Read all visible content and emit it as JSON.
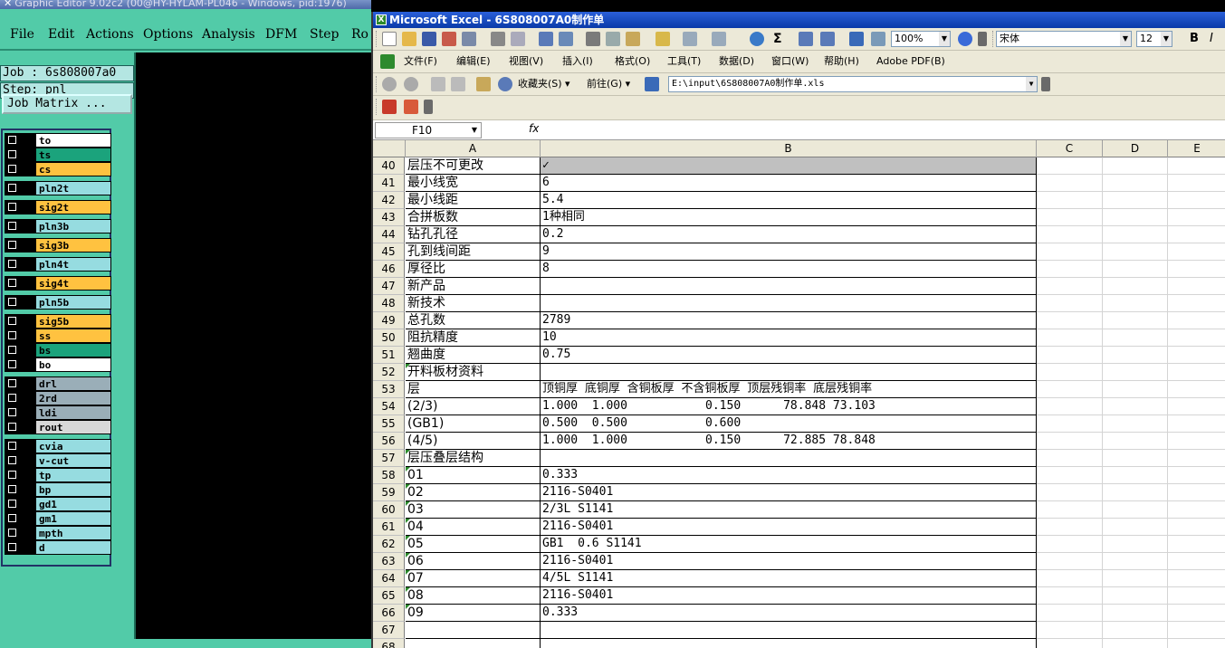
{
  "ge": {
    "title": "Graphic Editor 9.02c2 (00@HY-HYLAM-PL046 - Windows, pid:1976)",
    "menu": [
      "File",
      "Edit",
      "Actions",
      "Options",
      "Analysis",
      "DFM",
      "Step",
      "Ro"
    ],
    "job": "Job : 6s808007a0",
    "step": "Step: pnl",
    "job_matrix": "Job Matrix ...",
    "layers": [
      {
        "name": "to",
        "color": "#ffffff"
      },
      {
        "name": "ts",
        "color": "#1ba37c"
      },
      {
        "name": "cs",
        "color": "#ffc240"
      },
      {
        "name": "pln2t",
        "color": "#96dce0"
      },
      {
        "name": "sig2t",
        "color": "#ffc240"
      },
      {
        "name": "pln3b",
        "color": "#96dce0"
      },
      {
        "name": "sig3b",
        "color": "#ffc240"
      },
      {
        "name": "pln4t",
        "color": "#96dce0"
      },
      {
        "name": "sig4t",
        "color": "#ffc240"
      },
      {
        "name": "pln5b",
        "color": "#96dce0"
      },
      {
        "name": "sig5b",
        "color": "#ffc240"
      },
      {
        "name": "ss",
        "color": "#ffc240"
      },
      {
        "name": "bs",
        "color": "#1ba37c"
      },
      {
        "name": "bo",
        "color": "#ffffff"
      },
      {
        "name": "drl",
        "color": "#9aaeb8"
      },
      {
        "name": "2rd",
        "color": "#9aaeb8"
      },
      {
        "name": "ldi",
        "color": "#9aaeb8"
      },
      {
        "name": "rout",
        "color": "#d8d8d8"
      },
      {
        "name": "cvia",
        "color": "#96dce0"
      },
      {
        "name": "v-cut",
        "color": "#96dce0"
      },
      {
        "name": "tp",
        "color": "#96dce0"
      },
      {
        "name": "bp",
        "color": "#96dce0"
      },
      {
        "name": "gd1",
        "color": "#96dce0"
      },
      {
        "name": "gm1",
        "color": "#96dce0"
      },
      {
        "name": "mpth",
        "color": "#96dce0"
      },
      {
        "name": "d",
        "color": "#96dce0"
      }
    ]
  },
  "excel": {
    "title": "Microsoft Excel - 6S808007A0制作单",
    "zoom": "100%",
    "font": "宋体",
    "size": "12",
    "menu": [
      "文件(F)",
      "编辑(E)",
      "视图(V)",
      "插入(I)",
      "格式(O)",
      "工具(T)",
      "数据(D)",
      "窗口(W)",
      "帮助(H)",
      "Adobe PDF(B)"
    ],
    "favorites": "收藏夹(S) ▾",
    "goto": "前往(G) ▾",
    "address": "E:\\input\\6S808007A0制作单.xls",
    "namebox": "F10",
    "fx": "fx",
    "columns": [
      "A",
      "B",
      "C",
      "D",
      "E"
    ],
    "rows": [
      {
        "n": "40",
        "a": "层压不可更改",
        "b": "✓"
      },
      {
        "n": "41",
        "a": "最小线宽",
        "b": "6"
      },
      {
        "n": "42",
        "a": "最小线距",
        "b": "5.4"
      },
      {
        "n": "43",
        "a": "合拼板数",
        "b": "1种相同"
      },
      {
        "n": "44",
        "a": "钻孔孔径",
        "b": "0.2"
      },
      {
        "n": "45",
        "a": "孔到线间距",
        "b": "9"
      },
      {
        "n": "46",
        "a": "厚径比",
        "b": "8"
      },
      {
        "n": "47",
        "a": "新产品",
        "b": ""
      },
      {
        "n": "48",
        "a": "新技术",
        "b": ""
      },
      {
        "n": "49",
        "a": "总孔数",
        "b": "2789"
      },
      {
        "n": "50",
        "a": "阻抗精度",
        "b": "10"
      },
      {
        "n": "51",
        "a": "翘曲度",
        "b": "0.75"
      },
      {
        "n": "52",
        "a": "开料板材资料",
        "b": ""
      },
      {
        "n": "53",
        "a": "层",
        "b": "顶铜厚 底铜厚 含铜板厚 不含铜板厚 顶层残铜率 底层残铜率"
      },
      {
        "n": "54",
        "a": "(2/3)",
        "b": "1.000  1.000           0.150      78.848 73.103"
      },
      {
        "n": "55",
        "a": "(GB1)",
        "b": "0.500  0.500           0.600"
      },
      {
        "n": "56",
        "a": "(4/5)",
        "b": "1.000  1.000           0.150      72.885 78.848"
      },
      {
        "n": "57",
        "a": "层压叠层结构",
        "b": ""
      },
      {
        "n": "58",
        "a": "01",
        "b": "0.333"
      },
      {
        "n": "59",
        "a": "02",
        "b": "2116-S0401"
      },
      {
        "n": "60",
        "a": "03",
        "b": "2/3L S1141"
      },
      {
        "n": "61",
        "a": "04",
        "b": "2116-S0401"
      },
      {
        "n": "62",
        "a": "05",
        "b": "GB1  0.6 S1141"
      },
      {
        "n": "63",
        "a": "06",
        "b": "2116-S0401"
      },
      {
        "n": "64",
        "a": "07",
        "b": "4/5L S1141"
      },
      {
        "n": "65",
        "a": "08",
        "b": "2116-S0401"
      },
      {
        "n": "66",
        "a": "09",
        "b": "0.333"
      },
      {
        "n": "67",
        "a": "",
        "b": ""
      },
      {
        "n": "68",
        "a": "",
        "b": ""
      }
    ]
  }
}
